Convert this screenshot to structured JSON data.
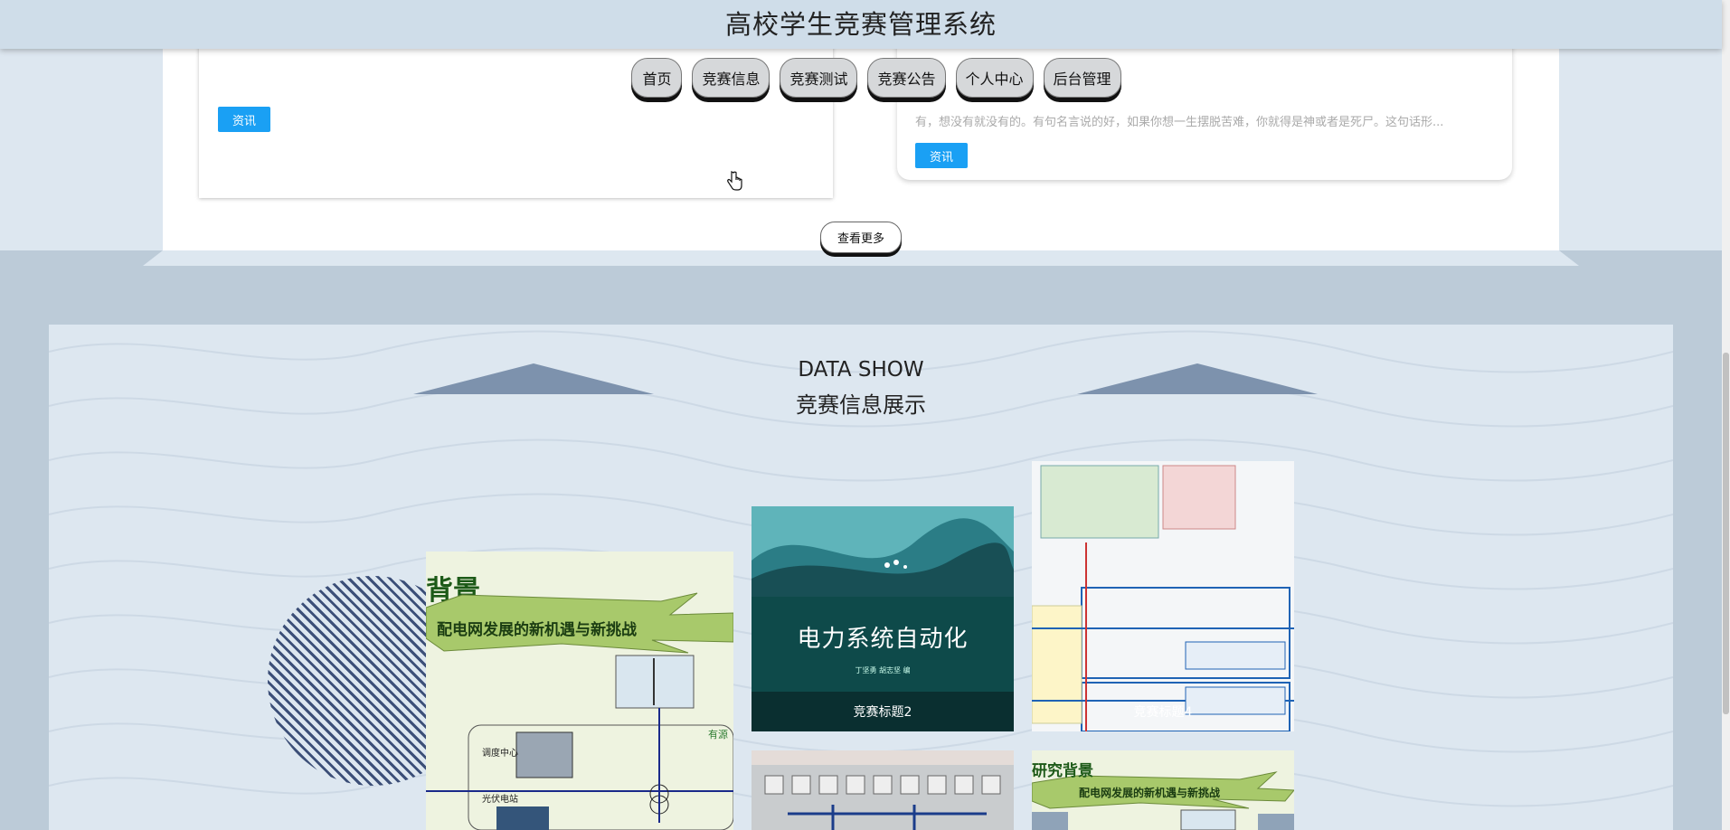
{
  "header": {
    "title": "高校学生竞赛管理系统"
  },
  "nav": {
    "items": [
      {
        "label": "首页"
      },
      {
        "label": "竞赛信息"
      },
      {
        "label": "竞赛测试"
      },
      {
        "label": "竞赛公告"
      },
      {
        "label": "个人中心"
      },
      {
        "label": "后台管理"
      }
    ]
  },
  "news": {
    "left_card": {
      "tag": "资讯"
    },
    "right_card": {
      "line1": "有，想没有就没有的。有句名言说的好，如果你想一生摆脱苦难，你就得是神或者是死尸。这句话形...",
      "tag": "资讯"
    },
    "more_label": "查看更多"
  },
  "data_show": {
    "title_en": "DATA SHOW",
    "title_cn": "竞赛信息展示",
    "tiles": [
      {
        "heading": "背景",
        "subheading": "配电网发展的新机遇与新挑战",
        "caption": ""
      },
      {
        "book_title": "电力系统自动化",
        "authors": "丁坚勇    胡志坚    编",
        "caption": "竞赛标题2"
      },
      {
        "caption": "竞赛标题4"
      },
      {
        "caption": ""
      },
      {
        "heading": "研究背景",
        "subheading": "配电网发展的新机遇与新挑战",
        "caption": ""
      }
    ]
  },
  "colors": {
    "accent": "#1aa0f4",
    "triangle": "#7d92ad",
    "band": "#bccbd8"
  }
}
